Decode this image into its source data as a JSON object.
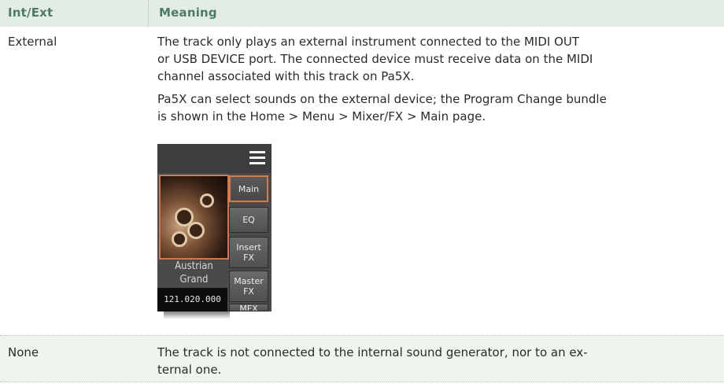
{
  "table": {
    "headers": {
      "col1": "Int/Ext",
      "col2": "Meaning"
    },
    "rows": [
      {
        "int_ext": "External",
        "meaning_lines": [
          "The track only plays an external instrument connected to the MIDI OUT",
          "or USB DEVICE port. The connected device must receive data on the MIDI",
          "channel associated with this track on Pa5X."
        ],
        "meaning2_lines": [
          "Pa5X can select sounds on the external device; the Program Change bundle",
          "is shown in the Home > Menu > Mixer/FX > Main page."
        ]
      },
      {
        "int_ext": "None",
        "meaning_lines": [
          "The track is not connected to the internal sound generator, nor to an ex-",
          "ternal one."
        ]
      }
    ]
  },
  "device_screen": {
    "menu_icon": "list-menu-icon",
    "sound_name_lines": [
      "Austrian",
      "Grand"
    ],
    "bank_code": "121.020.000",
    "tabs": [
      {
        "line1": "Main",
        "line2": "",
        "active": true
      },
      {
        "line1": "EQ",
        "line2": "",
        "active": false
      },
      {
        "line1": "Insert",
        "line2": "FX",
        "active": false
      },
      {
        "line1": "Master",
        "line2": "FX",
        "active": false
      },
      {
        "line1": "MFX",
        "line2": "",
        "active": false
      }
    ],
    "accent_color": "#d77a4d"
  }
}
